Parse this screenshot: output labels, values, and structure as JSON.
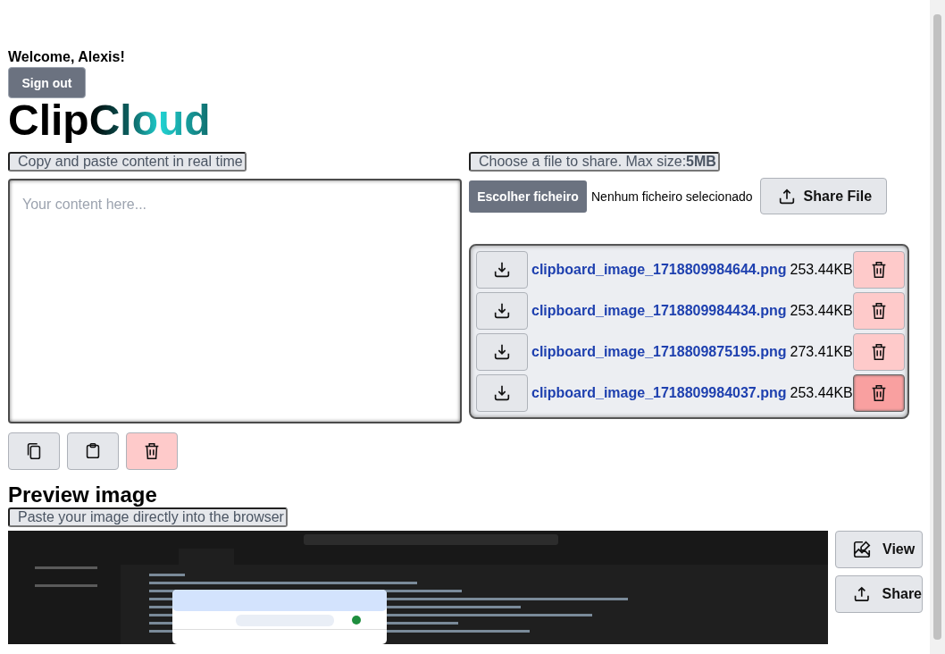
{
  "welcome": "Welcome, Alexis!",
  "sign_out": "Sign out",
  "logo": "ClipCloud",
  "clipboard": {
    "label": "Copy and paste content in real time",
    "placeholder": "Your content here...",
    "actions": [
      {
        "kind": "copy"
      },
      {
        "kind": "paste"
      },
      {
        "kind": "clear"
      }
    ]
  },
  "file_share": {
    "label": "Choose a file to share. Max size:**5MB**",
    "choose_button": "Escolher ficheiro",
    "file_status": "Nenhum ficheiro selecionado",
    "share_button": "Share File",
    "files": [
      {
        "name": "clipboard_image_1718809984644.png",
        "size": "253.44KB",
        "hovered": false
      },
      {
        "name": "clipboard_image_1718809984434.png",
        "size": "253.44KB",
        "hovered": false
      },
      {
        "name": "clipboard_image_1718809875195.png",
        "size": "273.41KB",
        "hovered": false
      },
      {
        "name": "clipboard_image_1718809984037.png",
        "size": "253.44KB",
        "hovered": true
      }
    ]
  },
  "preview": {
    "title": "Preview image",
    "label": "Paste your image directly into the browser",
    "view_button": "View",
    "share_button": "Share"
  }
}
